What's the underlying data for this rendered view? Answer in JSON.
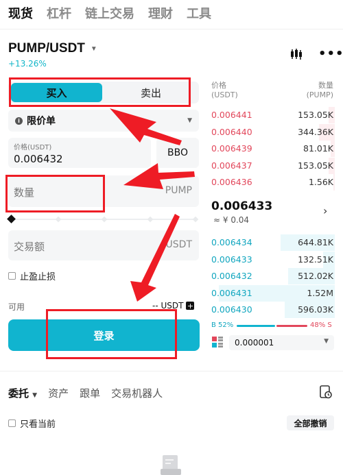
{
  "top_tabs": [
    "现货",
    "杠杆",
    "链上交易",
    "理财",
    "工具"
  ],
  "pair": {
    "symbol": "PUMP/USDT",
    "change": "+13.26%"
  },
  "toggle": {
    "buy": "买入",
    "sell": "卖出"
  },
  "order_type": "限价单",
  "price": {
    "label": "价格(USDT)",
    "value": "0.006432",
    "bbo": "BBO"
  },
  "quantity": {
    "label": "数量",
    "unit": "PUMP"
  },
  "amount": {
    "label": "交易额",
    "unit": "USDT"
  },
  "tpsl_label": "止盈止损",
  "available": {
    "label": "可用",
    "value": "-- USDT"
  },
  "login_button": "登录",
  "orderbook": {
    "price_header": [
      "价格",
      "(USDT)"
    ],
    "qty_header": [
      "数量",
      "(PUMP)"
    ],
    "asks": [
      {
        "price": "0.006441",
        "qty": "153.05K",
        "depth": 0.05
      },
      {
        "price": "0.006440",
        "qty": "344.36K",
        "depth": 0.12
      },
      {
        "price": "0.006439",
        "qty": "81.01K",
        "depth": 0.03
      },
      {
        "price": "0.006437",
        "qty": "153.05K",
        "depth": 0.05
      },
      {
        "price": "0.006436",
        "qty": "1.56K",
        "depth": 0.01
      }
    ],
    "last_price": "0.006433",
    "last_cny": "≈ ¥ 0.04",
    "bids": [
      {
        "price": "0.006434",
        "qty": "644.81K",
        "depth": 0.42
      },
      {
        "price": "0.006433",
        "qty": "132.51K",
        "depth": 0.09
      },
      {
        "price": "0.006432",
        "qty": "512.02K",
        "depth": 0.36
      },
      {
        "price": "0.006431",
        "qty": "1.52M",
        "depth": 0.9
      },
      {
        "price": "0.006430",
        "qty": "596.03K",
        "depth": 0.39
      }
    ],
    "buy_ratio": "B 52%",
    "sell_ratio": "48% S",
    "precision": "0.000001"
  },
  "bottom_tabs": [
    "委托",
    "资产",
    "跟单",
    "交易机器人"
  ],
  "only_current": "只看当前",
  "cancel_all": "全部撤销",
  "colors": {
    "accent": "#11b4cf",
    "ask": "#e2475b",
    "annotation": "#ee1c25"
  }
}
